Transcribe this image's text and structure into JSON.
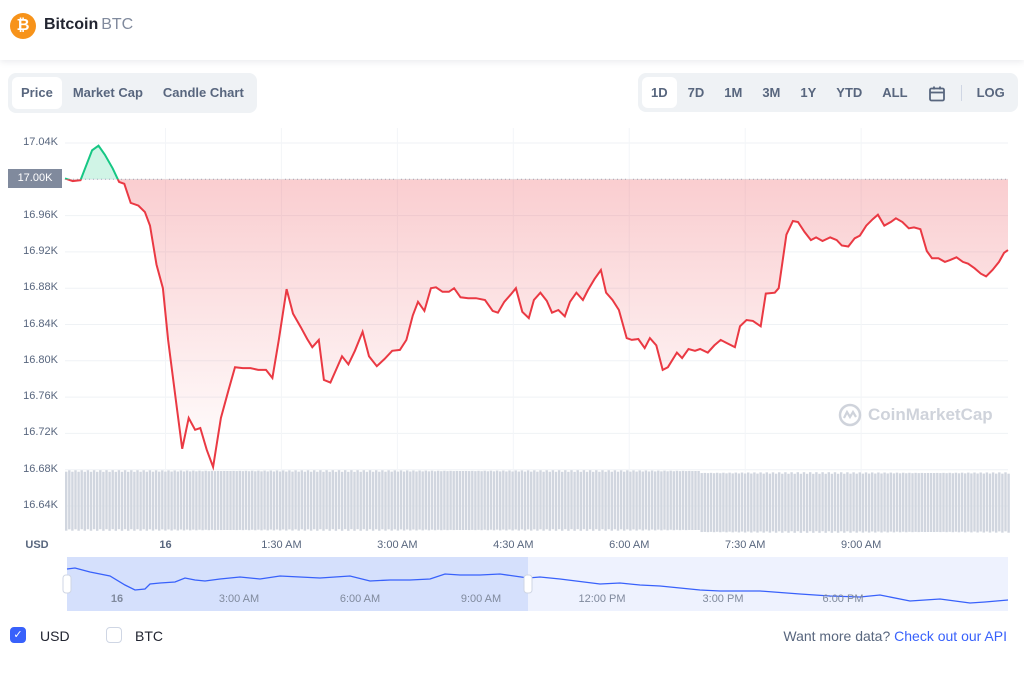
{
  "header": {
    "name": "Bitcoin",
    "symbol": "BTC",
    "logo_icon": "bitcoin-logo-icon"
  },
  "chart_tabs": [
    {
      "label": "Price",
      "active": true
    },
    {
      "label": "Market Cap"
    },
    {
      "label": "Candle Chart"
    }
  ],
  "ranges": [
    {
      "label": "1D",
      "active": true
    },
    {
      "label": "7D"
    },
    {
      "label": "1M"
    },
    {
      "label": "3M"
    },
    {
      "label": "1Y"
    },
    {
      "label": "YTD"
    },
    {
      "label": "ALL"
    }
  ],
  "log_label": "LOG",
  "watermark": "CoinMarketCap",
  "currency_label": "USD",
  "colors": {
    "up": "#16c784",
    "down": "#ea3943",
    "accent": "#3861fb"
  },
  "chart_data": {
    "type": "line",
    "ylabel": "USD",
    "y_ticks": [
      "17.04K",
      "17.00K",
      "16.96K",
      "16.92K",
      "16.88K",
      "16.84K",
      "16.80K",
      "16.76K",
      "16.72K",
      "16.68K",
      "16.64K"
    ],
    "y_tick_values": [
      17040,
      17000,
      16960,
      16920,
      16880,
      16840,
      16800,
      16760,
      16720,
      16680,
      16640
    ],
    "ylim": [
      16620,
      17060
    ],
    "baseline": 17000,
    "baseline_label": "17.00K",
    "x_ticks": [
      "16",
      "1:30 AM",
      "3:00 AM",
      "4:30 AM",
      "6:00 AM",
      "7:30 AM",
      "9:00 AM"
    ],
    "x_tick_times": [
      "00:00",
      "01:30",
      "03:00",
      "04:30",
      "06:00",
      "07:30",
      "09:00"
    ],
    "xlim": [
      "22:42",
      "10:54"
    ],
    "grid": true,
    "points": [
      [
        "22:42",
        17001
      ],
      [
        "22:48",
        16998
      ],
      [
        "22:54",
        16999
      ],
      [
        "23:03",
        17032
      ],
      [
        "23:08",
        17037
      ],
      [
        "23:13",
        17027
      ],
      [
        "23:19",
        17012
      ],
      [
        "23:24",
        16997
      ],
      [
        "23:28",
        16995
      ],
      [
        "23:33",
        16974
      ],
      [
        "23:39",
        16971
      ],
      [
        "23:44",
        16964
      ],
      [
        "23:48",
        16949
      ],
      [
        "23:53",
        16906
      ],
      [
        "23:58",
        16880
      ],
      [
        "00:02",
        16823
      ],
      [
        "00:09",
        16746
      ],
      [
        "00:13",
        16703
      ],
      [
        "00:18",
        16737
      ],
      [
        "00:23",
        16724
      ],
      [
        "00:27",
        16726
      ],
      [
        "00:32",
        16702
      ],
      [
        "00:37",
        16683
      ],
      [
        "00:43",
        16737
      ],
      [
        "00:49",
        16768
      ],
      [
        "00:54",
        16793
      ],
      [
        "01:00",
        16792
      ],
      [
        "01:06",
        16792
      ],
      [
        "01:12",
        16790
      ],
      [
        "01:18",
        16790
      ],
      [
        "01:23",
        16781
      ],
      [
        "01:28",
        16823
      ],
      [
        "01:34",
        16879
      ],
      [
        "01:39",
        16852
      ],
      [
        "01:45",
        16837
      ],
      [
        "01:50",
        16824
      ],
      [
        "01:54",
        16815
      ],
      [
        "01:59",
        16823
      ],
      [
        "02:03",
        16779
      ],
      [
        "02:08",
        16776
      ],
      [
        "02:13",
        16792
      ],
      [
        "02:17",
        16805
      ],
      [
        "02:22",
        16796
      ],
      [
        "02:27",
        16811
      ],
      [
        "02:33",
        16832
      ],
      [
        "02:38",
        16805
      ],
      [
        "02:44",
        16794
      ],
      [
        "02:50",
        16802
      ],
      [
        "02:56",
        16811
      ],
      [
        "03:02",
        16812
      ],
      [
        "03:07",
        16823
      ],
      [
        "03:12",
        16850
      ],
      [
        "03:16",
        16865
      ],
      [
        "03:21",
        16855
      ],
      [
        "03:26",
        16880
      ],
      [
        "03:30",
        16881
      ],
      [
        "03:35",
        16876
      ],
      [
        "03:40",
        16876
      ],
      [
        "03:44",
        16880
      ],
      [
        "03:49",
        16870
      ],
      [
        "03:55",
        16869
      ],
      [
        "04:01",
        16869
      ],
      [
        "04:08",
        16867
      ],
      [
        "04:14",
        16855
      ],
      [
        "04:18",
        16853
      ],
      [
        "04:23",
        16865
      ],
      [
        "04:28",
        16873
      ],
      [
        "04:32",
        16880
      ],
      [
        "04:37",
        16854
      ],
      [
        "04:42",
        16847
      ],
      [
        "04:46",
        16867
      ],
      [
        "04:51",
        16875
      ],
      [
        "04:56",
        16866
      ],
      [
        "05:00",
        16853
      ],
      [
        "05:05",
        16856
      ],
      [
        "05:10",
        16849
      ],
      [
        "05:14",
        16865
      ],
      [
        "05:19",
        16875
      ],
      [
        "05:24",
        16867
      ],
      [
        "05:28",
        16878
      ],
      [
        "05:33",
        16890
      ],
      [
        "05:38",
        16900
      ],
      [
        "05:42",
        16875
      ],
      [
        "05:47",
        16867
      ],
      [
        "05:52",
        16856
      ],
      [
        "05:58",
        16825
      ],
      [
        "06:02",
        16823
      ],
      [
        "06:07",
        16824
      ],
      [
        "06:12",
        16814
      ],
      [
        "06:16",
        16825
      ],
      [
        "06:21",
        16817
      ],
      [
        "06:26",
        16790
      ],
      [
        "06:30",
        16793
      ],
      [
        "06:37",
        16809
      ],
      [
        "06:41",
        16803
      ],
      [
        "06:46",
        16813
      ],
      [
        "06:51",
        16811
      ],
      [
        "06:55",
        16813
      ],
      [
        "07:01",
        16809
      ],
      [
        "07:06",
        16817
      ],
      [
        "07:11",
        16823
      ],
      [
        "07:15",
        16820
      ],
      [
        "07:22",
        16815
      ],
      [
        "07:26",
        16838
      ],
      [
        "07:31",
        16845
      ],
      [
        "07:36",
        16844
      ],
      [
        "07:42",
        16838
      ],
      [
        "07:46",
        16874
      ],
      [
        "07:53",
        16875
      ],
      [
        "07:56",
        16880
      ],
      [
        "08:02",
        16939
      ],
      [
        "08:07",
        16954
      ],
      [
        "08:11",
        16953
      ],
      [
        "08:16",
        16942
      ],
      [
        "08:21",
        16933
      ],
      [
        "08:25",
        16936
      ],
      [
        "08:30",
        16932
      ],
      [
        "08:36",
        16936
      ],
      [
        "08:41",
        16933
      ],
      [
        "08:45",
        16927
      ],
      [
        "08:50",
        16926
      ],
      [
        "08:55",
        16935
      ],
      [
        "08:59",
        16938
      ],
      [
        "09:04",
        16949
      ],
      [
        "09:09",
        16956
      ],
      [
        "09:13",
        16961
      ],
      [
        "09:18",
        16949
      ],
      [
        "09:23",
        16953
      ],
      [
        "09:27",
        16957
      ],
      [
        "09:32",
        16953
      ],
      [
        "09:37",
        16946
      ],
      [
        "09:41",
        16947
      ],
      [
        "09:46",
        16945
      ],
      [
        "09:51",
        16921
      ],
      [
        "09:55",
        16913
      ],
      [
        "10:00",
        16913
      ],
      [
        "10:05",
        16909
      ],
      [
        "10:09",
        16911
      ],
      [
        "10:14",
        16914
      ],
      [
        "10:19",
        16909
      ],
      [
        "10:23",
        16907
      ],
      [
        "10:28",
        16902
      ],
      [
        "10:33",
        16896
      ],
      [
        "10:37",
        16893
      ],
      [
        "10:42",
        16900
      ],
      [
        "10:47",
        16909
      ],
      [
        "10:51",
        16919
      ],
      [
        "10:54",
        16922
      ]
    ]
  },
  "navigator": {
    "x_ticks": [
      "16",
      "3:00 AM",
      "6:00 AM",
      "9:00 AM",
      "12:00 PM",
      "3:00 PM",
      "6:00 PM"
    ]
  },
  "currency_toggles": [
    {
      "label": "USD",
      "checked": true
    },
    {
      "label": "BTC",
      "checked": false
    }
  ],
  "footer": {
    "text": "Want more data?",
    "link": "Check out our API"
  }
}
